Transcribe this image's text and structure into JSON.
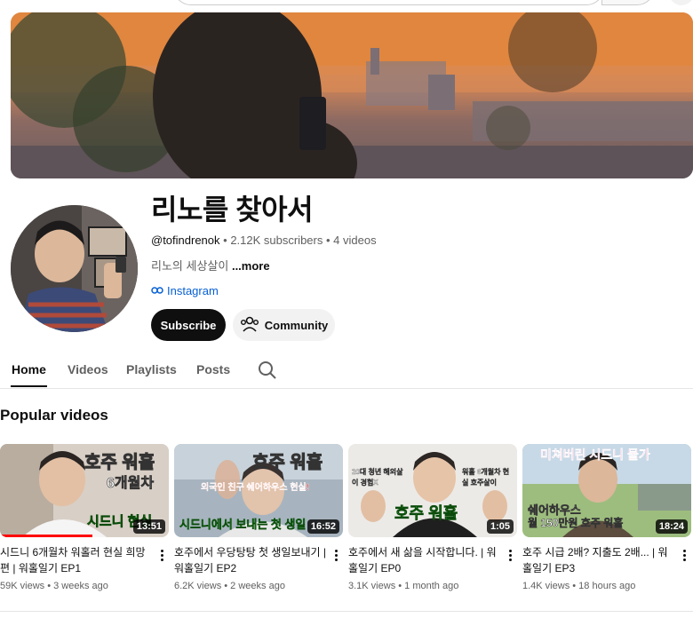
{
  "channel": {
    "title": "리노를 찾아서",
    "handle": "@tofindrenok",
    "subscribers": "2.12K subscribers",
    "videos_count": "4 videos",
    "separator": " • ",
    "description": "리노의 세상살이 ",
    "more_label": "...more",
    "link_label": "Instagram"
  },
  "buttons": {
    "subscribe": "Subscribe",
    "community": "Community"
  },
  "tabs": [
    {
      "label": "Home"
    },
    {
      "label": "Videos"
    },
    {
      "label": "Playlists"
    },
    {
      "label": "Posts"
    }
  ],
  "section": {
    "title": "Popular videos"
  },
  "videos": [
    {
      "title": "시드니 6개월차 워홀러 현실 희망편 | 워홀일기 EP1",
      "views": "59K views",
      "age": "3 weeks ago",
      "duration": "13:51",
      "overlay_top": "호주 워홀",
      "overlay_sub": "6개월차",
      "overlay_bottom": "시드니 현실",
      "progress": 0.55
    },
    {
      "title": "호주에서 우당탕탕 첫 생일보내기 | 워홀일기 EP2",
      "views": "6.2K views",
      "age": "2 weeks ago",
      "duration": "16:52",
      "overlay_top": "호주 워홀",
      "overlay_sub": "외국인 친구 쉐어하우스 현실!",
      "overlay_bottom": "시드니에서 보내는 첫 생일"
    },
    {
      "title": "호주에서 새 삶을 시작합니다. | 워홀일기 EP0",
      "views": "3.1K views",
      "age": "1 month ago",
      "duration": "1:05",
      "overlay_top": "20대 청년 해외살이 경험X",
      "overlay_sub": "워홀 6개월차 현실 호주살이",
      "overlay_bottom": "호주 워홀"
    },
    {
      "title": "호주 시급 2배? 지출도 2배... | 워홀일기 EP3",
      "views": "1.4K views",
      "age": "18 hours ago",
      "duration": "18:24",
      "overlay_top": "미쳐버린 시드니 물가",
      "overlay_sub": "쉐어하우스",
      "overlay_bottom": "월 150만원 호주 워홀"
    }
  ],
  "colors": {
    "accent": "#0f0f0f",
    "link": "#065fd4",
    "progress": "#ff0000",
    "overlay_green": "#3cff3c"
  },
  "icons": {
    "link": "link-icon",
    "community": "community-icon",
    "search": "search-icon",
    "more": "more-vert-icon"
  }
}
